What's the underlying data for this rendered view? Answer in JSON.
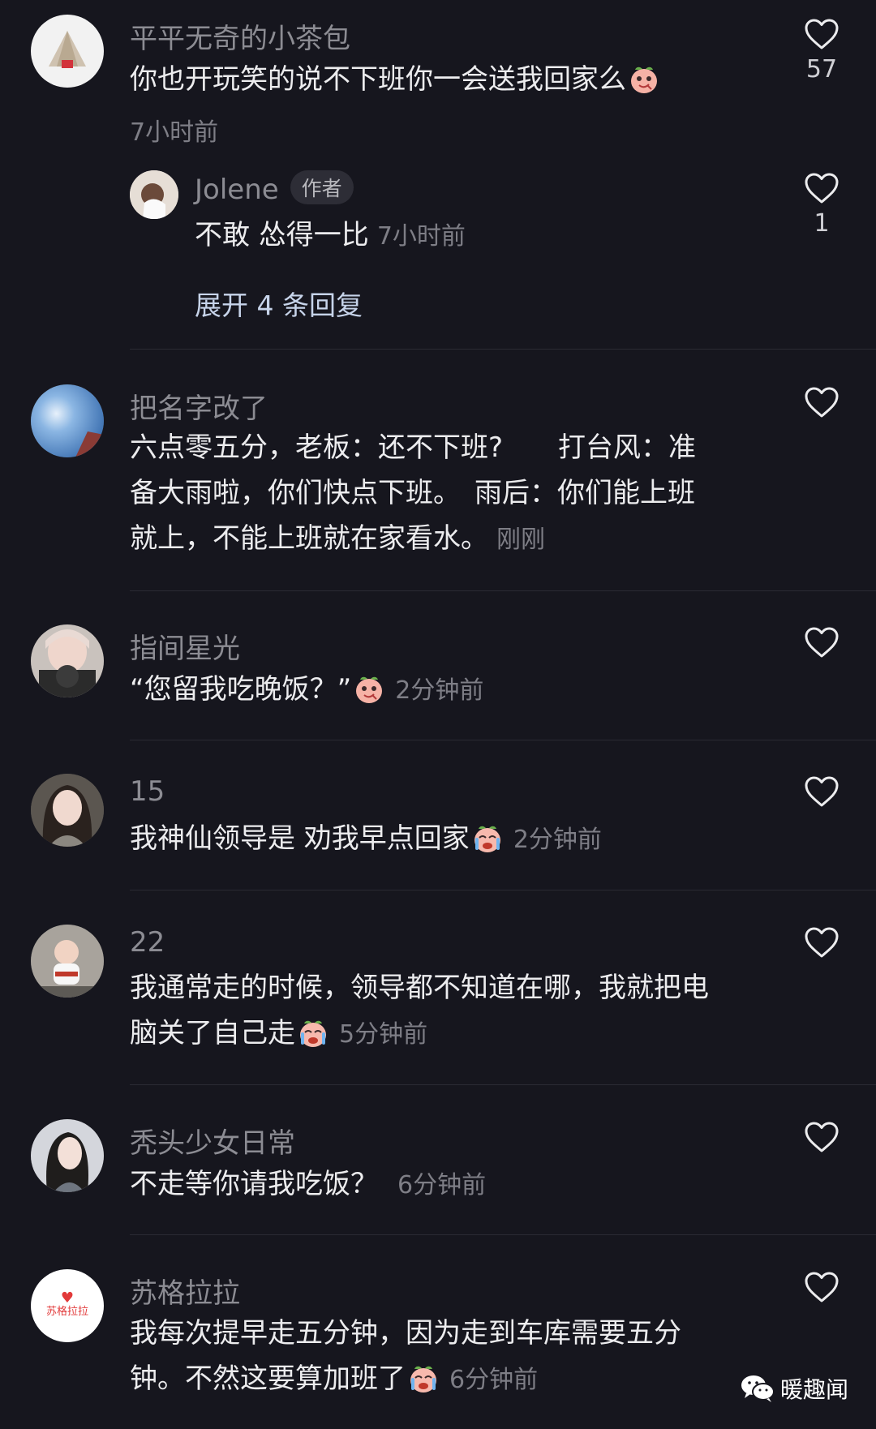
{
  "comments": [
    {
      "user": "平平无奇的小茶包",
      "text": "你也开玩笑的说不下班你一会送我回家么",
      "time": "7小时前",
      "likes": "57",
      "reply": {
        "user": "Jolene",
        "badge": "作者",
        "text": "不敢 怂得一比",
        "time": "7小时前",
        "likes": "1"
      },
      "expand": "展开 4 条回复"
    },
    {
      "user": "把名字改了",
      "lines": [
        "六点零五分，老板：还不下班?　　打台风：准",
        "备大雨啦，你们快点下班。　雨后：你们能上班",
        "就上，不能上班就在家看水。"
      ],
      "time": "刚刚"
    },
    {
      "user": "指间星光",
      "text": "“您留我吃晚饭？”",
      "time": "2分钟前"
    },
    {
      "user": "15",
      "text": "我神仙领导是 劝我早点回家",
      "time": "2分钟前"
    },
    {
      "user": "22",
      "lines": [
        "我通常走的时候，领导都不知道在哪，我就把电",
        "脑关了自己走"
      ],
      "time": "5分钟前"
    },
    {
      "user": "秃头少女日常",
      "text": "不走等你请我吃饭？",
      "time": "6分钟前"
    },
    {
      "user": "苏格拉拉",
      "avatar_text": "苏格拉拉",
      "lines": [
        "我每次提早走五分钟，因为走到车库需要五分",
        "钟。不然这要算加班了"
      ],
      "time": "6分钟前"
    }
  ],
  "watermark": {
    "label": "暖趣闻",
    "icon": "wechat-icon"
  },
  "icons": {
    "like": "heart-outline-icon",
    "emoji_grin": "peach-grin-emoji",
    "emoji_cry": "peach-cry-emoji"
  },
  "colors": {
    "background": "#16161e",
    "username": "#8c8c93",
    "text": "#ececee",
    "expand_link": "#c7d4ea"
  }
}
